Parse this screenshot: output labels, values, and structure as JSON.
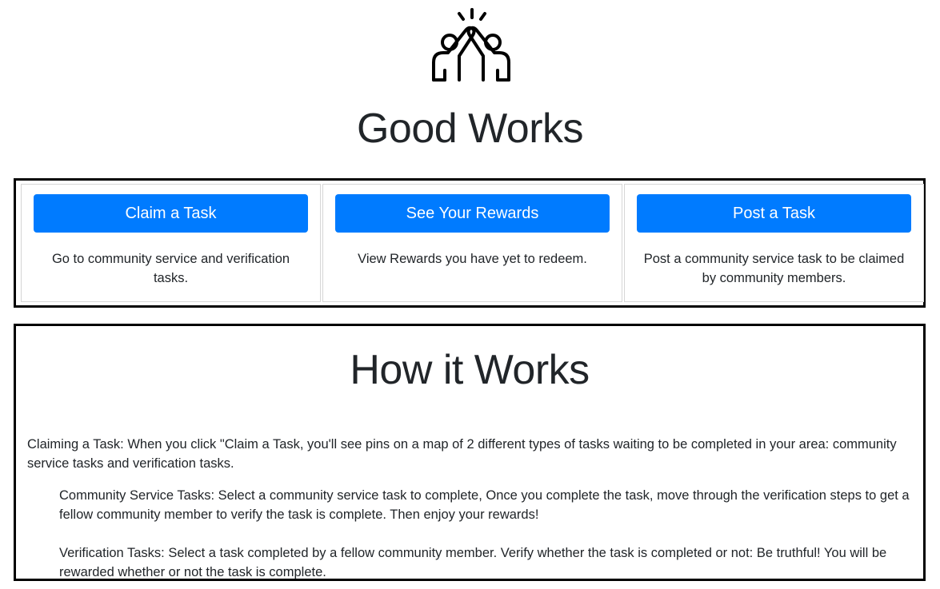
{
  "app": {
    "logo_icon": "high-five-icon",
    "title": "Good Works"
  },
  "actions": [
    {
      "button_label": "Claim a Task",
      "description": "Go to community service and verification tasks."
    },
    {
      "button_label": "See Your Rewards",
      "description": "View Rewards you have yet to redeem."
    },
    {
      "button_label": "Post a Task",
      "description": "Post a community service task to be claimed by community members."
    }
  ],
  "how": {
    "title": "How it Works",
    "intro": "Claiming a Task: When you click \"Claim a Task, you'll see pins on a map of 2 different types of tasks waiting to be completed in your area: community service tasks and verification tasks.",
    "community": "Community Service Tasks: Select a community service task to complete, Once you complete the task, move through the verification steps to get a fellow community member to verify the task is complete. Then enjoy your rewards!",
    "verification": "Verification Tasks: Select a task completed by a fellow community member. Verify whether the task is completed or not: Be truthful! You will be rewarded whether or not the task is complete."
  },
  "colors": {
    "primary": "#007bff",
    "text": "#212529",
    "border": "#000000"
  }
}
